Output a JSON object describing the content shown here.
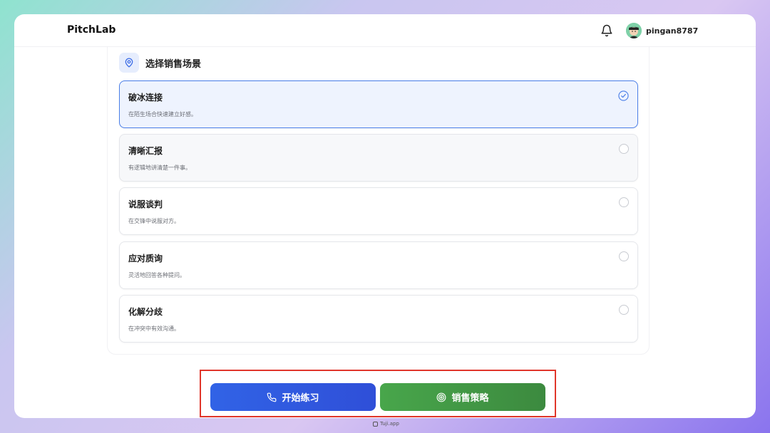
{
  "app": {
    "name": "PitchLab"
  },
  "header": {
    "username": "pingan8787"
  },
  "section": {
    "title": "选择销售场景"
  },
  "scenarios": [
    {
      "title": "破冰连接",
      "desc": "在陌生场合快速建立好感。",
      "selected": true
    },
    {
      "title": "清晰汇报",
      "desc": "有逻辑地讲清楚一件事。",
      "selected": false
    },
    {
      "title": "说服谈判",
      "desc": "在交锋中说服对方。",
      "selected": false
    },
    {
      "title": "应对质询",
      "desc": "灵活地回答各种提问。",
      "selected": false
    },
    {
      "title": "化解分歧",
      "desc": "在冲突中有效沟通。",
      "selected": false
    }
  ],
  "actions": {
    "start_label": "开始练习",
    "strategy_label": "销售策略"
  },
  "footer": {
    "mark": "Tuji.app"
  },
  "colors": {
    "accent": "#3163e6",
    "green": "#48a64b",
    "highlight": "#e0362b"
  },
  "icons": {
    "bell": "bell-icon",
    "pin": "location-pin-icon",
    "phone": "phone-icon",
    "target": "target-icon",
    "check": "check-circle-icon"
  }
}
